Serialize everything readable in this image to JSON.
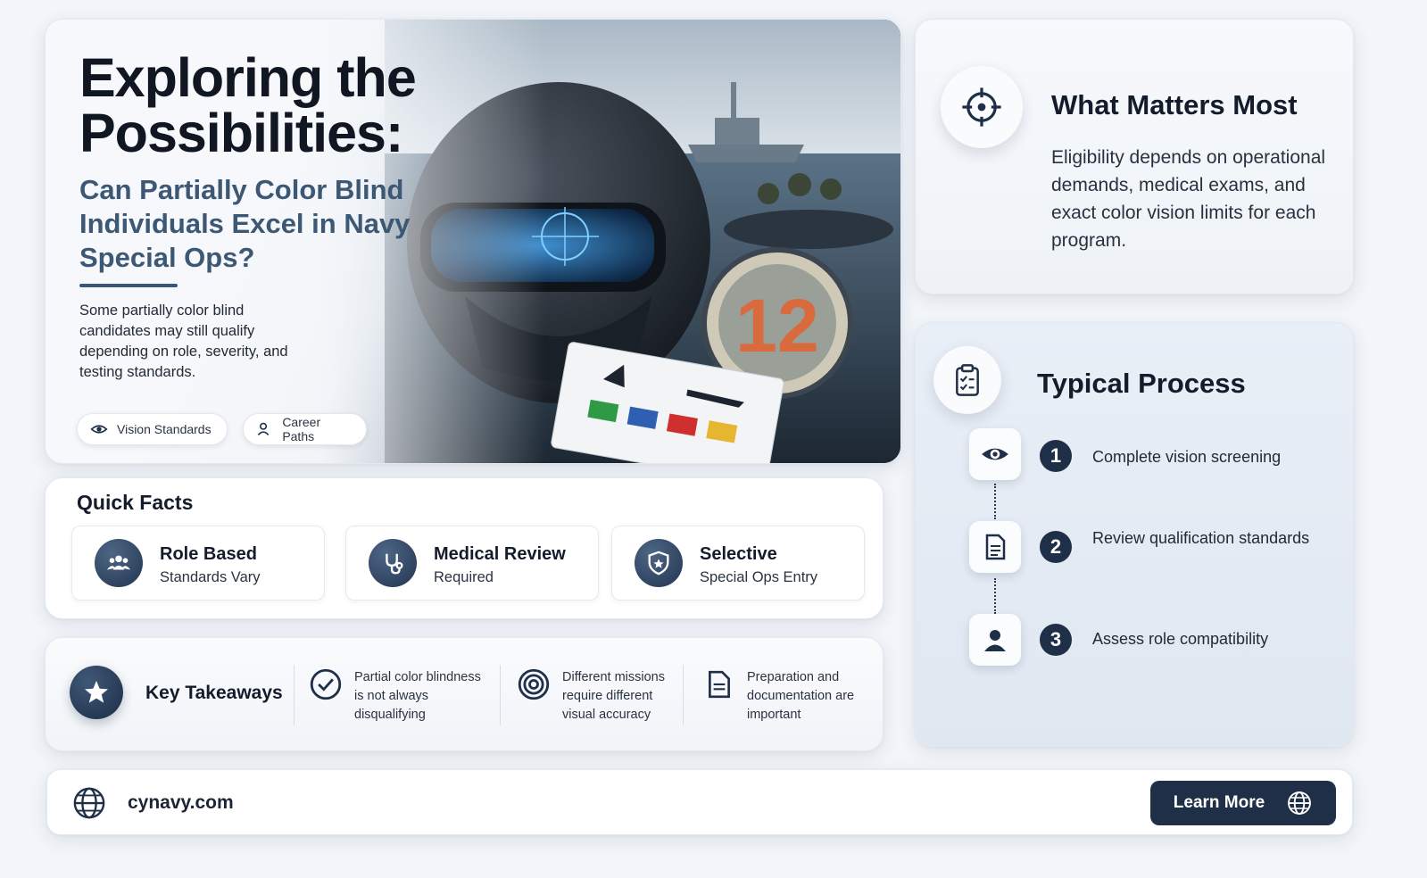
{
  "hero": {
    "title": "Exploring the Possibilities:",
    "subtitle": "Can Partially Color Blind Individuals Excel in Navy Special Ops?",
    "description": "Some partially color blind candidates may still qualify depending on role, severity, and testing standards.",
    "chips": [
      {
        "label": "Vision Standards",
        "icon": "eye-icon"
      },
      {
        "label": "Career Paths",
        "icon": "person-icon"
      }
    ],
    "plate_number": "12"
  },
  "matters": {
    "title": "What Matters Most",
    "body": "Eligibility depends on operational demands, medical exams, and exact color vision limits for each program.",
    "icon": "crosshair-icon"
  },
  "process": {
    "title": "Typical Process",
    "icon": "clipboard-icon",
    "steps": [
      {
        "num": "1",
        "text": "Complete vision screening",
        "icon": "eye-icon"
      },
      {
        "num": "2",
        "text": "Review qualification standards",
        "icon": "document-icon"
      },
      {
        "num": "3",
        "text": "Assess role compatibility",
        "icon": "person-icon"
      }
    ]
  },
  "facts": {
    "heading": "Quick Facts",
    "items": [
      {
        "title": "Role Based",
        "sub": "Standards Vary",
        "icon": "group-icon"
      },
      {
        "title": "Medical Review",
        "sub": "Required",
        "icon": "stethoscope-icon"
      },
      {
        "title": "Selective",
        "sub": "Special Ops Entry",
        "icon": "shield-icon"
      }
    ]
  },
  "takeaways": {
    "title": "Key Takeaways",
    "items": [
      {
        "text": "Partial color blindness is not always disqualifying",
        "icon": "check-circle-icon"
      },
      {
        "text": "Different missions require different visual accuracy",
        "icon": "target-icon"
      },
      {
        "text": "Preparation and documentation are important",
        "icon": "document-icon"
      }
    ]
  },
  "footer": {
    "site": "cynavy.com",
    "button_label": "Learn More"
  },
  "colors": {
    "navy": "#1f2f47",
    "slate_blue": "#3c5875",
    "background": "#f2f5f9"
  }
}
